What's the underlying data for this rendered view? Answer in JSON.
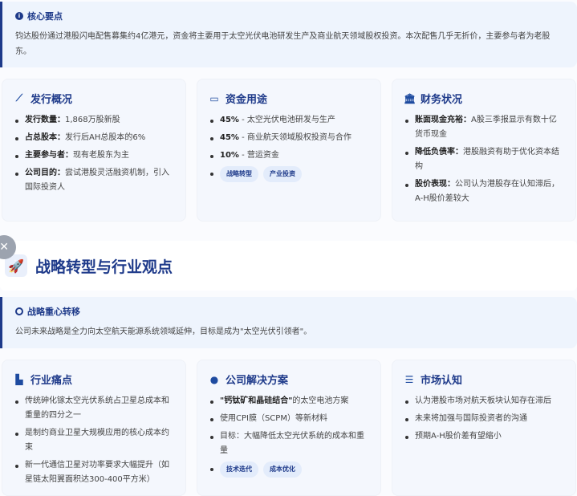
{
  "key_points": {
    "title": "核心要点",
    "text": "钧达股份通过港股闪电配售募集约4亿港元，资金将主要用于太空光伏电池研发生产及商业航天领域股权投资。本次配售几乎无折价，主要参与者为老股东。"
  },
  "cards_top": [
    {
      "title": "发行概况",
      "icon": "chart-line-icon",
      "items": [
        {
          "label": "发行数量：",
          "text": "1,868万股新股"
        },
        {
          "label": "占总股本：",
          "text": "发行后AH总股本的6%"
        },
        {
          "label": "主要参与者：",
          "text": "现有老股东为主"
        },
        {
          "label": "公司目的：",
          "text": "尝试港股灵活融资机制，引入国际投资人"
        }
      ]
    },
    {
      "title": "资金用途",
      "icon": "money-card-icon",
      "items": [
        {
          "label": "45%",
          "text": " - 太空光伏电池研发与生产"
        },
        {
          "label": "45%",
          "text": " - 商业航天领域股权投资与合作"
        },
        {
          "label": "10%",
          "text": " - 营运资金"
        }
      ],
      "tags": [
        "战略转型",
        "产业投资"
      ]
    },
    {
      "title": "财务状况",
      "icon": "bank-icon",
      "items": [
        {
          "label": "账面现金充裕：",
          "text": "A股三季报显示有数十亿货币现金"
        },
        {
          "label": "降低负债率：",
          "text": "港股融资有助于优化资本结构"
        },
        {
          "label": "股价表现：",
          "text": "公司认为港股存在认知滞后，A-H股价差较大"
        }
      ]
    }
  ],
  "section": {
    "title": "战略转型与行业观点"
  },
  "strategy": {
    "title": "战略重心转移",
    "text": "公司未来战略是全力向太空航天能源系统领域延伸，目标是成为\"太空光伏引领者\"。"
  },
  "cards_bottom": [
    {
      "title": "行业痛点",
      "icon": "industry-icon",
      "items": [
        {
          "label": "",
          "text": "传统砷化镓太空光伏系统占卫星总成本和重量的四分之一"
        },
        {
          "label": "",
          "text": "是制约商业卫星大规模应用的核心成本约束"
        },
        {
          "label": "",
          "text": "新一代通信卫星对功率要求大幅提升（如星链太阳翼面积达300-400平方米）"
        }
      ]
    },
    {
      "title": "公司解决方案",
      "icon": "lightbulb-icon",
      "items": [
        {
          "label": "\"钙钛矿和晶硅结合\"",
          "text": "的太空电池方案"
        },
        {
          "label": "",
          "text": "使用CPI膜（SCPM）等新材料"
        },
        {
          "label": "",
          "text": "目标：大幅降低太空光伏系统的成本和重量"
        }
      ],
      "tags": [
        "技术迭代",
        "成本优化"
      ]
    },
    {
      "title": "市场认知",
      "icon": "chart-area-icon",
      "items": [
        {
          "label": "",
          "text": "认为港股市场对航天板块认知存在滞后"
        },
        {
          "label": "",
          "text": "未来将加强与国际投资者的沟通"
        },
        {
          "label": "",
          "text": "预期A-H股价差有望缩小"
        }
      ]
    }
  ]
}
